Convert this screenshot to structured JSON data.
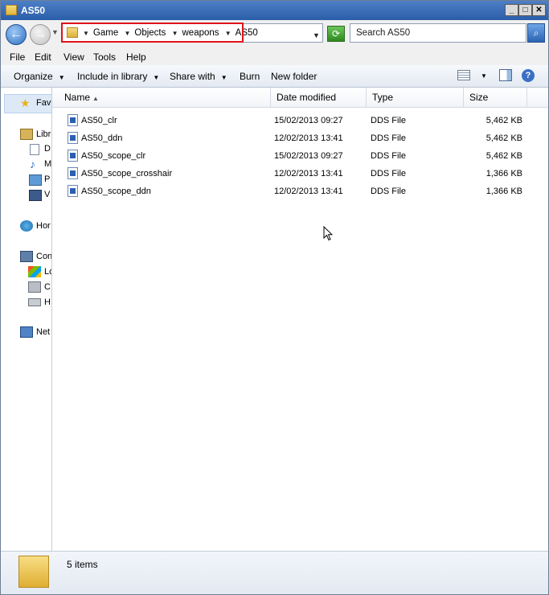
{
  "window": {
    "title": "AS50"
  },
  "address": {
    "crumbs": [
      "Game",
      "Objects",
      "weapons",
      "AS50"
    ]
  },
  "search": {
    "placeholder": "Search AS50"
  },
  "menu": {
    "items": [
      "File",
      "Edit",
      "View",
      "Tools",
      "Help"
    ]
  },
  "toolbar": {
    "organize": "Organize",
    "include": "Include in library",
    "share": "Share with",
    "burn": "Burn",
    "new_folder": "New folder"
  },
  "nav": {
    "favorites": "Fav",
    "libraries": "Libr",
    "lib_items": [
      "D",
      "M",
      "P",
      "V"
    ],
    "homegroup": "Hor",
    "computer": "Con",
    "comp_items": [
      "Lo",
      "C",
      "H"
    ],
    "network": "Net"
  },
  "columns": {
    "name": "Name",
    "date": "Date modified",
    "type": "Type",
    "size": "Size"
  },
  "files": [
    {
      "name": "AS50_clr",
      "date": "15/02/2013 09:27",
      "type": "DDS File",
      "size": "5,462 KB"
    },
    {
      "name": "AS50_ddn",
      "date": "12/02/2013 13:41",
      "type": "DDS File",
      "size": "5,462 KB"
    },
    {
      "name": "AS50_scope_clr",
      "date": "15/02/2013 09:27",
      "type": "DDS File",
      "size": "5,462 KB"
    },
    {
      "name": "AS50_scope_crosshair",
      "date": "12/02/2013 13:41",
      "type": "DDS File",
      "size": "1,366 KB"
    },
    {
      "name": "AS50_scope_ddn",
      "date": "12/02/2013 13:41",
      "type": "DDS File",
      "size": "1,366 KB"
    }
  ],
  "status": {
    "count": "5 items"
  }
}
